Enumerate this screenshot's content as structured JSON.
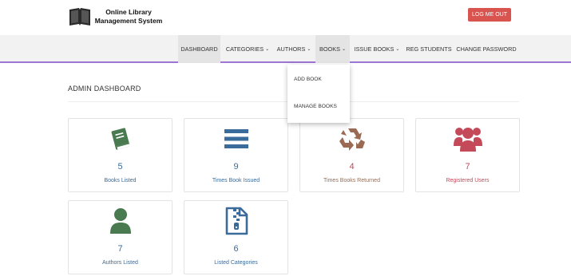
{
  "header": {
    "brand_line1": "Online Library",
    "brand_line2": "Management System",
    "logout_label": "LOG ME OUT"
  },
  "nav": {
    "items": [
      {
        "label": "DASHBOARD",
        "has_dropdown": false,
        "active": true
      },
      {
        "label": "CATEGORIES",
        "has_dropdown": true
      },
      {
        "label": "AUTHORS",
        "has_dropdown": true
      },
      {
        "label": "BOOKS",
        "has_dropdown": true
      },
      {
        "label": "ISSUE BOOKS",
        "has_dropdown": true
      },
      {
        "label": "REG STUDENTS",
        "has_dropdown": false
      },
      {
        "label": "CHANGE PASSWORD",
        "has_dropdown": false
      }
    ]
  },
  "books_dropdown": {
    "items": [
      "ADD BOOK",
      "MANAGE BOOKS"
    ]
  },
  "page": {
    "title": "ADMIN DASHBOARD"
  },
  "cards": [
    {
      "value": "5",
      "label": "Books Listed",
      "icon": "book-icon",
      "color": "#4a7a4f"
    },
    {
      "value": "9",
      "label": "Times Book Issued",
      "icon": "list-icon",
      "color": "#3b6b9a"
    },
    {
      "value": "4",
      "label": "Times Books Returned",
      "icon": "recycle-icon",
      "color": "#9a6b52"
    },
    {
      "value": "7",
      "label": "Registered Users",
      "icon": "users-icon",
      "color": "#c44a5a"
    },
    {
      "value": "7",
      "label": "Authors Listed",
      "icon": "user-icon",
      "color": "#4a7a4f"
    },
    {
      "value": "6",
      "label": "Listed Categories",
      "icon": "file-zip-icon",
      "color": "#3b6b9a"
    }
  ],
  "colors": {
    "accent_bar": "#9d75d2",
    "logout_bg": "#d9534f",
    "green": "#4a7a4f",
    "blue": "#3b6b9a",
    "brown": "#9a6b52",
    "red": "#c44a5a"
  }
}
